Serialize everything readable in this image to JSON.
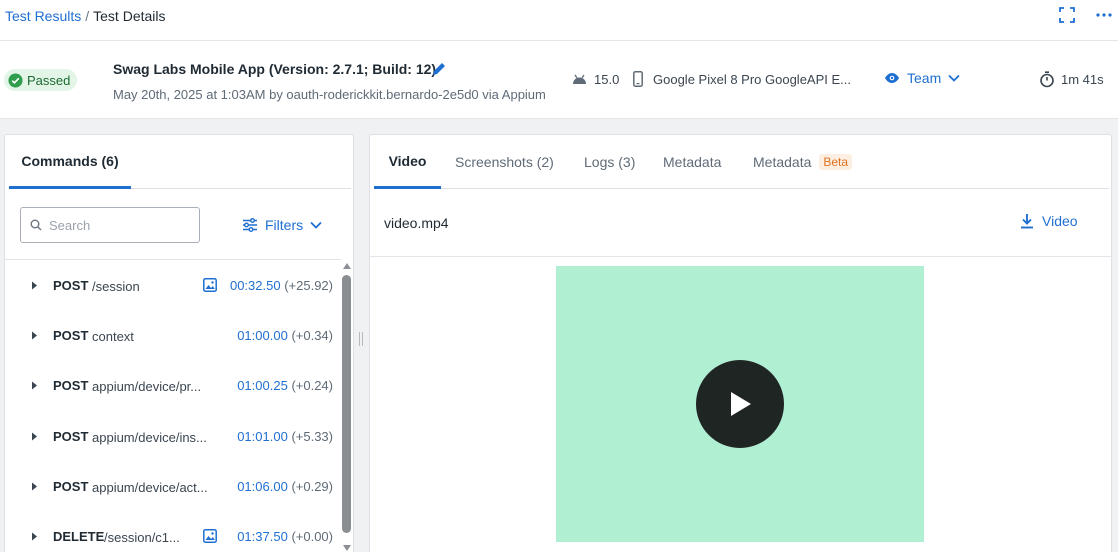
{
  "breadcrumb": {
    "parent": "Test Results",
    "separator": "/",
    "current": "Test Details"
  },
  "header": {
    "status": "Passed",
    "title": "Swag Labs Mobile App (Version: 2.7.1; Build: 12)",
    "subtitle": "May 20th, 2025 at 1:03AM by oauth-roderickkit.bernardo-2e5d0 via Appium",
    "os_version": "15.0",
    "device": "Google Pixel 8 Pro GoogleAPI E...",
    "visibility": "Team",
    "duration": "1m 41s"
  },
  "commands_panel": {
    "tab_label": "Commands (6)",
    "search_placeholder": "Search",
    "filters_label": "Filters",
    "rows": [
      {
        "method": "POST",
        "path": "/session",
        "time": "00:32.50",
        "delta": "(+25.92)",
        "has_screenshot": true
      },
      {
        "method": "POST",
        "path": "context",
        "time": "01:00.00",
        "delta": "(+0.34)",
        "has_screenshot": false
      },
      {
        "method": "POST",
        "path": "appium/device/pr...",
        "time": "01:00.25",
        "delta": "(+0.24)",
        "has_screenshot": false
      },
      {
        "method": "POST",
        "path": "appium/device/ins...",
        "time": "01:01.00",
        "delta": "(+5.33)",
        "has_screenshot": false
      },
      {
        "method": "POST",
        "path": "appium/device/act...",
        "time": "01:06.00",
        "delta": "(+0.29)",
        "has_screenshot": false
      },
      {
        "method": "DELETE",
        "path": "/session/c1...",
        "time": "01:37.50",
        "delta": "(+0.00)",
        "has_screenshot": true
      }
    ]
  },
  "detail_panel": {
    "tabs": [
      {
        "label": "Video",
        "active": true
      },
      {
        "label": "Screenshots (2)",
        "active": false
      },
      {
        "label": "Logs (3)",
        "active": false
      },
      {
        "label": "Metadata",
        "active": false
      },
      {
        "label": "Metadata",
        "badge": "Beta",
        "active": false
      }
    ],
    "file_name": "video.mp4",
    "download_label": "Video"
  },
  "colors": {
    "accent": "#1f6fd1",
    "passed_bg": "#e3f5e6",
    "passed_icon": "#2e9d4d",
    "video_placeholder": "#b1efd3",
    "play_button": "#1e2522",
    "beta_text": "#e07320"
  },
  "icons": [
    "expand-icon",
    "more-icon",
    "check-circle-icon",
    "edit-icon",
    "android-icon",
    "phone-icon",
    "eye-icon",
    "chevron-down-icon",
    "timer-icon",
    "search-icon",
    "filters-icon",
    "caret-right-icon",
    "image-icon",
    "download-icon",
    "play-icon"
  ]
}
